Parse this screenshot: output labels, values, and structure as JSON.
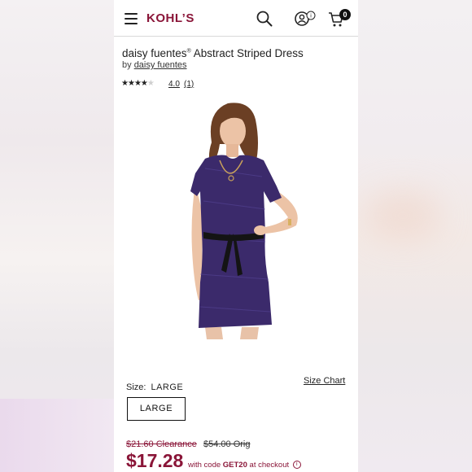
{
  "brand": {
    "logo_text": "KOHLS",
    "color": "#8a1538"
  },
  "header": {
    "menu_icon": "hamburger-menu-icon",
    "search_icon": "search-icon",
    "account_icon": "account-icon",
    "cart_icon": "cart-icon",
    "cart_count": "0"
  },
  "product": {
    "brand_name": "daisy fuentes",
    "brand_mark": "®",
    "name": "Abstract Striped Dress",
    "by_prefix": "by",
    "by_brand": "daisy fuentes",
    "rating_stars_filled": 4,
    "rating_value": "4.0",
    "rating_count": "(1)"
  },
  "size": {
    "label": "Size:",
    "selected": "LARGE",
    "chart_link": "Size Chart",
    "options": [
      "LARGE"
    ]
  },
  "pricing": {
    "clearance_text": "$21.60 Clearance",
    "orig_text": "$54.00 Orig",
    "sale_price": "$17.28",
    "promo_prefix": "with code",
    "promo_code": "GET20",
    "promo_suffix": "at checkout"
  },
  "colors": {
    "accent": "#8a1538",
    "dress": "#3b2a6b",
    "hair": "#6b3f24"
  }
}
